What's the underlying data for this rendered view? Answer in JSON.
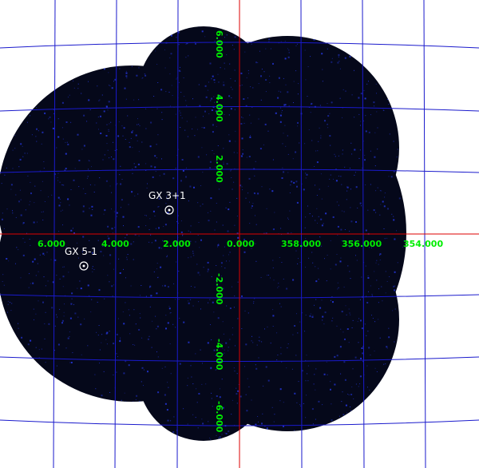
{
  "colors": {
    "background": "#ffffff",
    "sky": "#05081a",
    "grid": "#1a1acc",
    "axis": "#dd0000",
    "tick_label": "#00ee00",
    "source": "#ffffff",
    "noise": "#2233cc"
  },
  "axes": {
    "longitude_ticks": [
      "6.000",
      "4.000",
      "2.000",
      "0.000",
      "358.000",
      "356.000",
      "354.000"
    ],
    "latitude_ticks": [
      "6.000",
      "4.000",
      "2.000",
      "-2.000",
      "-4.000",
      "-6.000"
    ]
  },
  "sources": [
    {
      "name": "GX 3+1"
    },
    {
      "name": "GX 5-1"
    }
  ]
}
